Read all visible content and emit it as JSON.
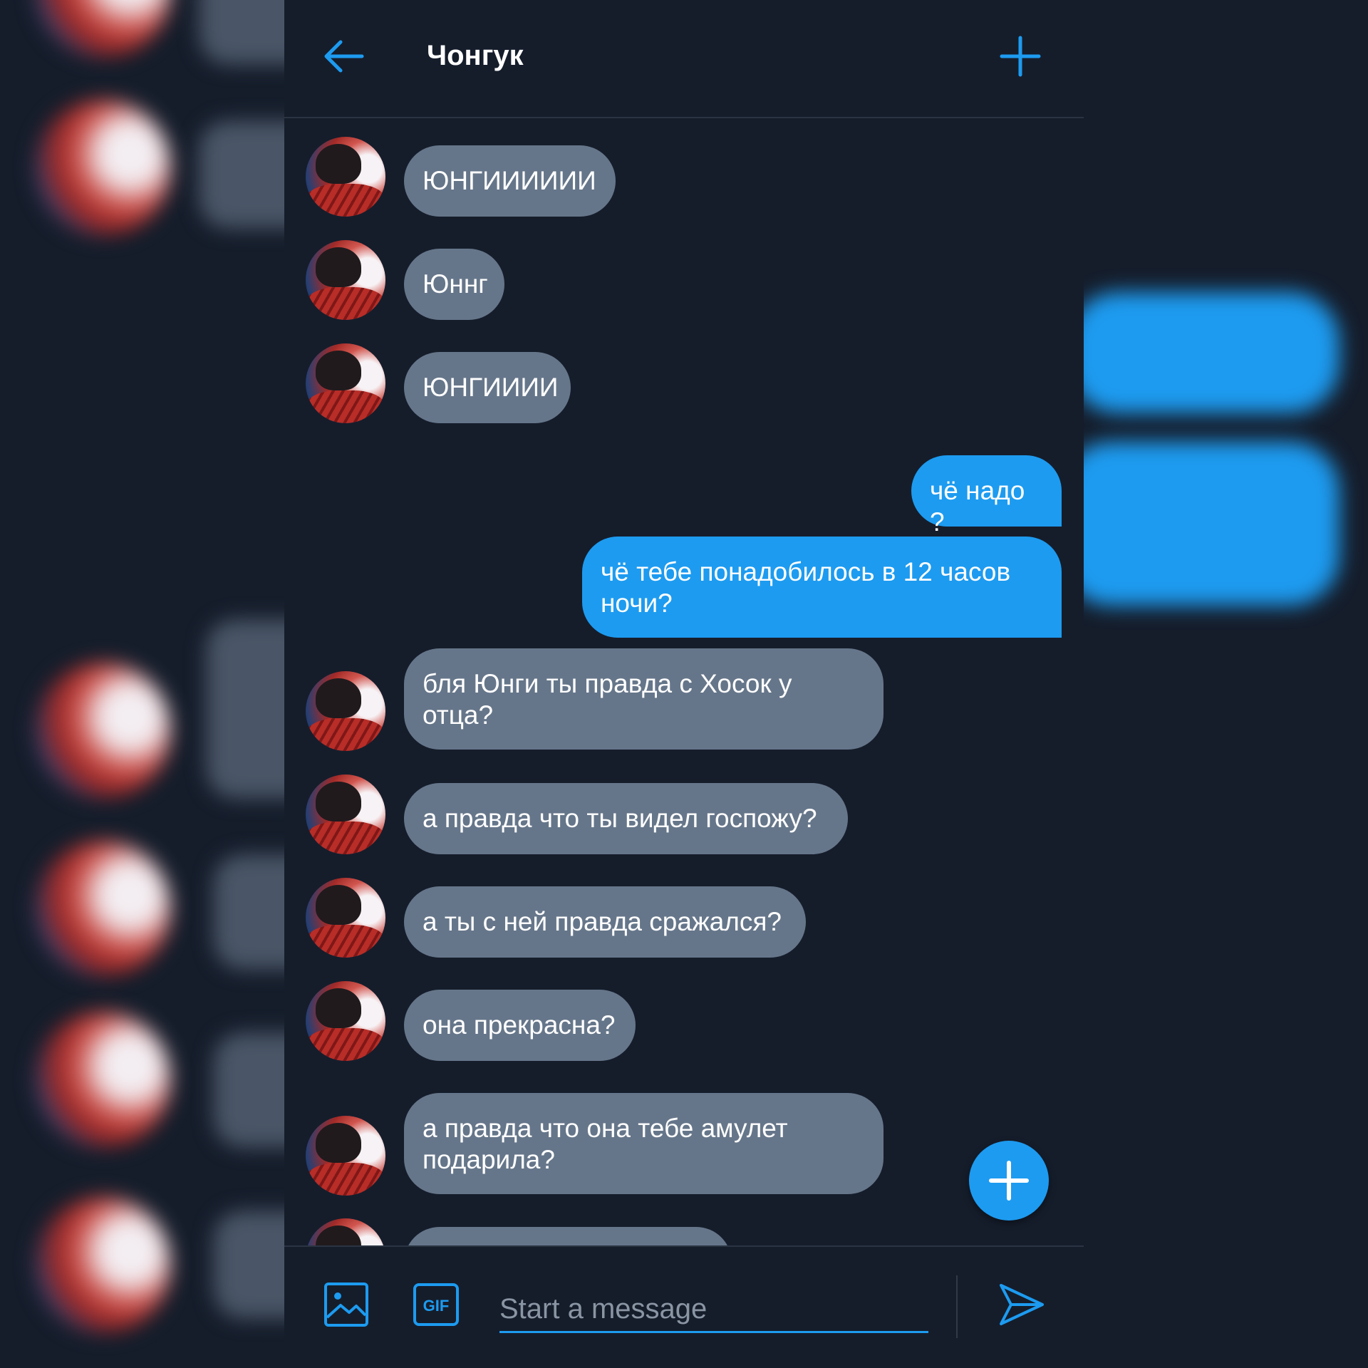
{
  "header": {
    "title": "Чонгук"
  },
  "icons": {
    "back": "arrow-left-icon",
    "add": "plus-icon",
    "image": "image-icon",
    "gif": "gif-icon",
    "send": "send-icon",
    "fab": "plus-icon"
  },
  "gif_label": "GIF",
  "messages": [
    {
      "from": "them",
      "text": "ЮНГИИИИИИ"
    },
    {
      "from": "them",
      "text": "Юннг"
    },
    {
      "from": "them",
      "text": "ЮНГИИИИ"
    },
    {
      "from": "me",
      "text": "чё надо ?"
    },
    {
      "from": "me",
      "text": "чё тебе понадобилось в 12 часов ночи?"
    },
    {
      "from": "them",
      "text": "бля Юнги ты правда с Хосок у отца?"
    },
    {
      "from": "them",
      "text": "а правда что ты видел госпожу?"
    },
    {
      "from": "them",
      "text": "а ты с ней правда сражался?"
    },
    {
      "from": "them",
      "text": "она прекрасна?"
    },
    {
      "from": "them",
      "text": "а правда что она тебе амулет подарила?"
    }
  ],
  "composer": {
    "placeholder": "Start a message"
  },
  "colors": {
    "background": "#151d2b",
    "accent": "#1d9bf0",
    "incoming_bubble": "#66768a"
  }
}
